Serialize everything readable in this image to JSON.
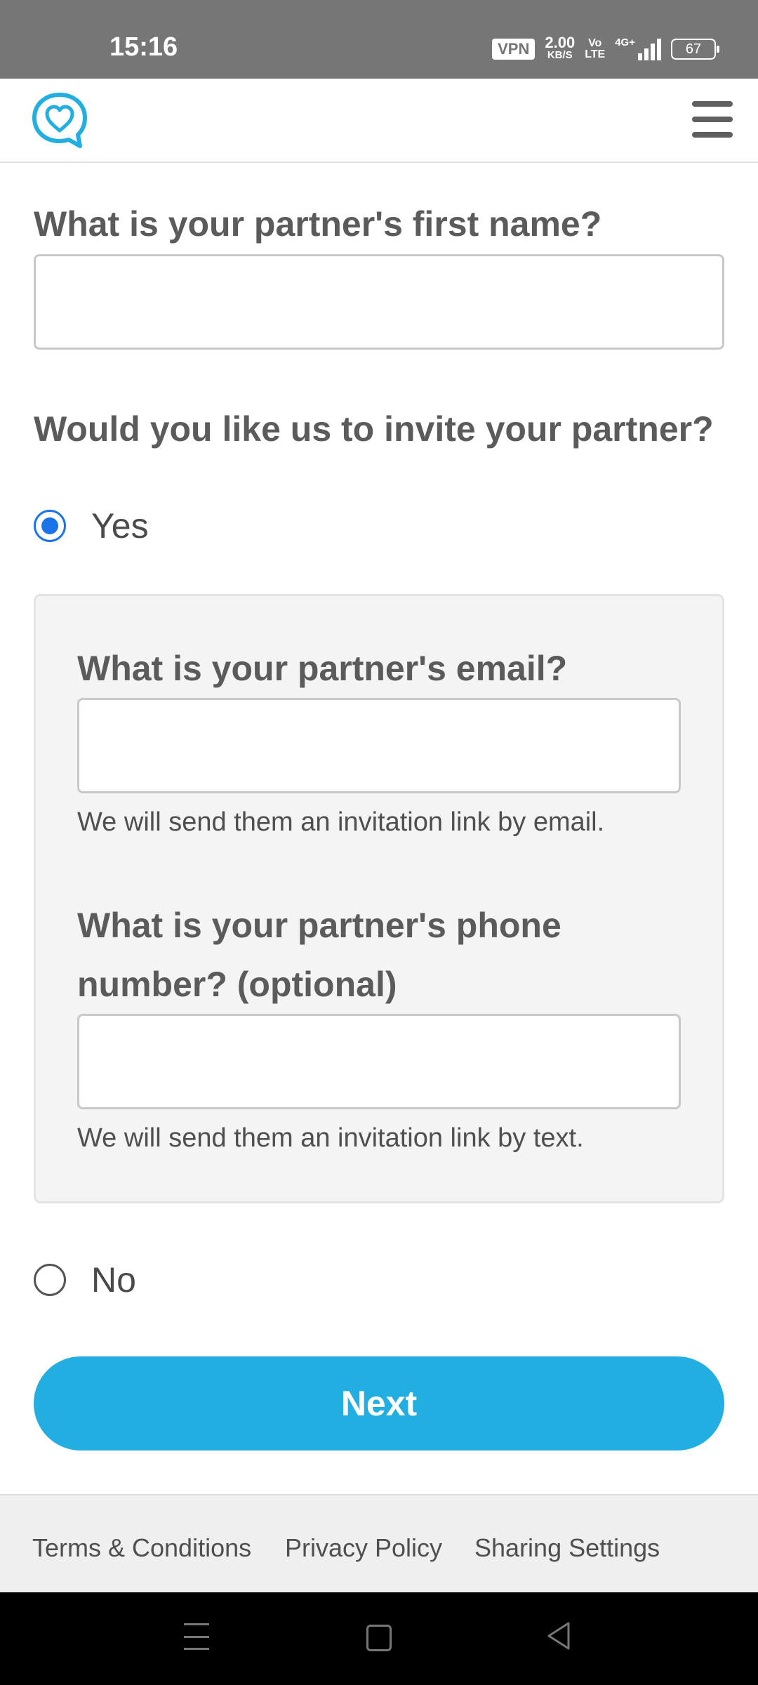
{
  "status_bar": {
    "time": "15:16",
    "vpn": "VPN",
    "speed_value": "2.00",
    "speed_unit": "KB/S",
    "volte_top": "Vo",
    "volte_bottom": "LTE",
    "network": "4G+",
    "battery": "67"
  },
  "header": {
    "logo_icon": "heart-chat-bubble-icon",
    "menu_icon": "hamburger-menu-icon",
    "brand_color": "#22aee1"
  },
  "form": {
    "first_name_question": "What is your partner's first name?",
    "first_name_value": "",
    "invite_question": "Would you like us to invite your partner?",
    "options": {
      "yes_label": "Yes",
      "yes_selected": true,
      "no_label": "No",
      "no_selected": false
    },
    "email_question": "What is your partner's email?",
    "email_value": "",
    "email_hint": "We will send them an invitation link by email.",
    "phone_question": "What is your partner's phone number? (optional)",
    "phone_value": "",
    "phone_hint": "We will send them an invitation link by text.",
    "next_label": "Next"
  },
  "footer": {
    "links": [
      "Terms & Conditions",
      "Privacy Policy",
      "Sharing Settings"
    ]
  },
  "nav_bar": {
    "recent_icon": "recent-apps-icon",
    "home_icon": "home-icon",
    "back_icon": "back-icon"
  }
}
